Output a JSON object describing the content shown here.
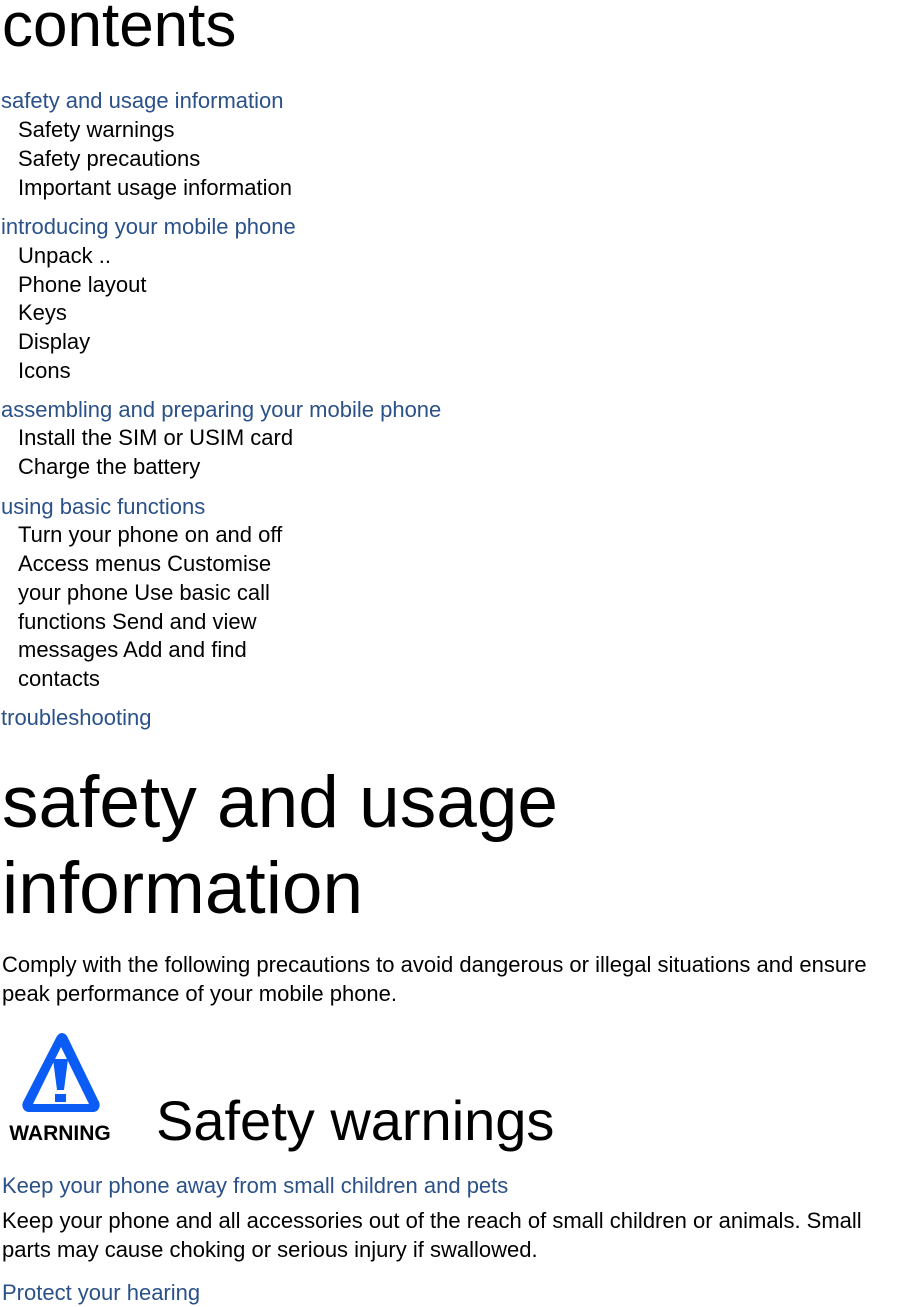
{
  "contents": {
    "title": "contents",
    "sections": [
      {
        "label": "safety and usage information",
        "items": [
          "Safety warnings",
          "Safety precautions",
          "Important usage information"
        ]
      },
      {
        "label": "introducing your mobile phone",
        "items": [
          "Unpack  ..",
          "Phone layout",
          "Keys",
          "Display",
          "Icons"
        ]
      },
      {
        "label": "assembling and preparing your mobile phone",
        "items": [
          "Install the SIM or USIM card",
          "Charge the battery"
        ]
      },
      {
        "label": "using basic functions",
        "items": [
          "Turn your phone on and off",
          "Access menus Customise your phone Use basic call functions Send and view messages Add and find contacts"
        ]
      },
      {
        "label": "troubleshooting",
        "items": []
      }
    ]
  },
  "safety": {
    "title": "safety and usage information",
    "intro": "Comply with the following precautions to avoid dangerous or illegal situations and ensure peak performance of your mobile phone.",
    "warning_icon": {
      "semantic": "warning-triangle-icon",
      "label": "WARNING",
      "color": "#0a5cf5"
    },
    "warnings_title": "Safety warnings",
    "topics": [
      {
        "heading": "Keep your phone away from small children and pets",
        "body": "Keep your phone and all accessories out of the reach of small children or animals. Small parts may cause choking or serious injury if swallowed."
      },
      {
        "heading": "Protect your hearing",
        "body": ""
      }
    ]
  },
  "colors": {
    "section_heading": "#2b5189",
    "body_text": "#000000"
  }
}
